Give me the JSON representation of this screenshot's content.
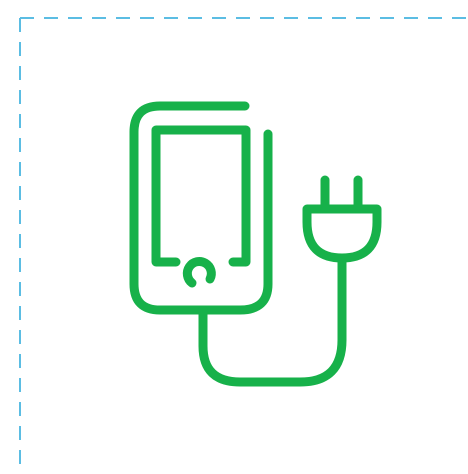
{
  "icon": {
    "name": "phone-charger-icon",
    "color": "#17b14a"
  },
  "frame": {
    "border_color": "#5bbde3",
    "style": "dashed"
  }
}
